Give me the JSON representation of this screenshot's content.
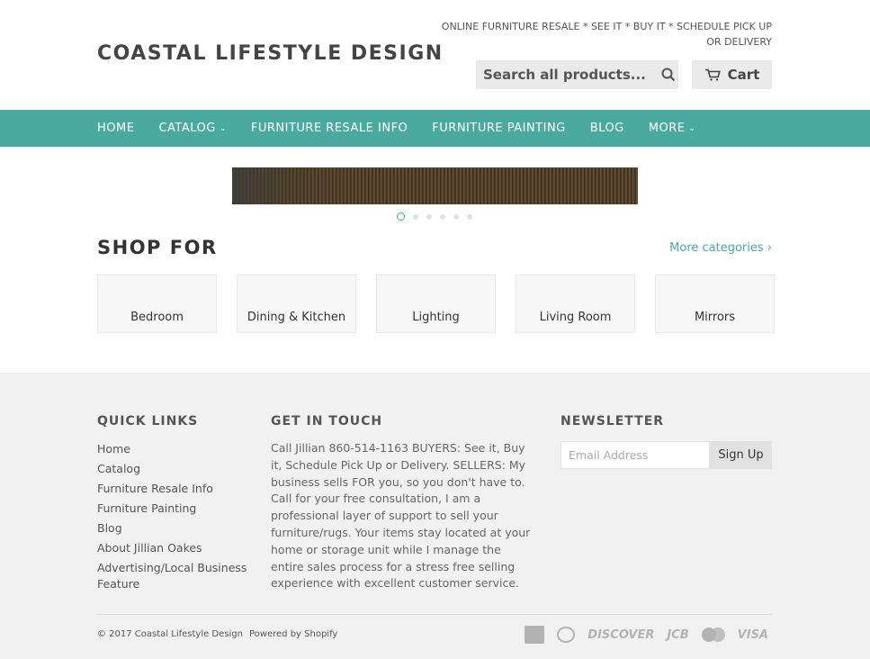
{
  "header": {
    "logo": "COASTAL LIFESTYLE DESIGN",
    "tagline": "ONLINE FURNITURE RESALE * SEE IT * BUY IT * SCHEDULE PICK UP OR DELIVERY",
    "search_placeholder": "Search all products...",
    "search_icon": "search-icon",
    "cart_label": "Cart",
    "cart_icon": "cart-icon"
  },
  "nav": {
    "items": [
      {
        "label": "HOME"
      },
      {
        "label": "CATALOG",
        "dropdown": true
      },
      {
        "label": "FURNITURE RESALE INFO"
      },
      {
        "label": "FURNITURE PAINTING"
      },
      {
        "label": "BLOG"
      },
      {
        "label": "MORE",
        "dropdown": true
      }
    ],
    "bg_color": "#4aaa9f"
  },
  "slider": {
    "dot_count": 6,
    "active_index": 0
  },
  "shop": {
    "title": "SHOP FOR",
    "more_link": "More categories ›",
    "categories": [
      "Bedroom",
      "Dining & Kitchen",
      "Lighting",
      "Living Room",
      "Mirrors"
    ]
  },
  "footer": {
    "quick_links_title": "QUICK LINKS",
    "quick_links": [
      "Home",
      "Catalog",
      "Furniture Resale Info",
      "Furniture Painting",
      "Blog",
      "About Jillian Oakes",
      "Advertising/Local Business Feature"
    ],
    "touch_title": "GET IN TOUCH",
    "touch_text": "Call Jillian 860-514-1163 BUYERS: See it, Buy it, Schedule Pick Up or Delivery. SELLERS: My business sells FOR you, so you don't have to. Call for your free consultation, I am a professional layer of support to sell your furniture/rugs. Your items stay located at your home or storage unit while I manage the entire sales process for a stress free selling experience with excellent customer service.",
    "newsletter_title": "NEWSLETTER",
    "email_placeholder": "Email Address",
    "signup_label": "Sign Up",
    "copyright": "© 2017 Coastal Lifestyle Design",
    "powered": "Powered by Shopify",
    "payments": {
      "discover": "DISCOVER",
      "jcb": "JCB",
      "visa": "VISA"
    }
  }
}
